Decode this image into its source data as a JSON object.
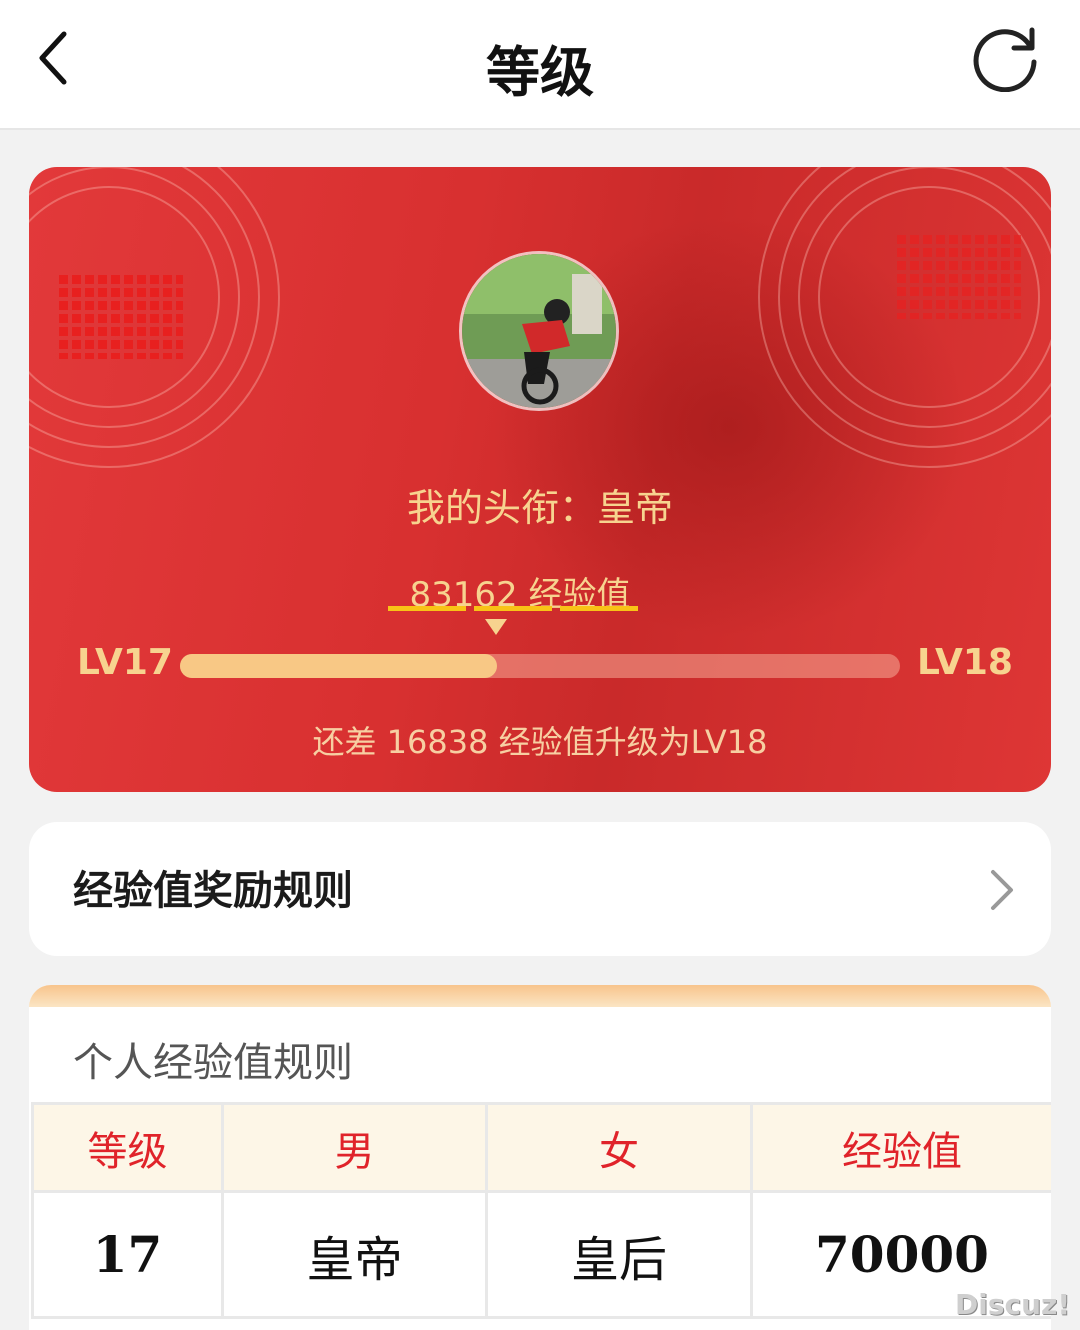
{
  "header": {
    "title": "等级",
    "back_icon": "chevron-left-icon",
    "refresh_icon": "refresh-icon"
  },
  "level_card": {
    "honor_label": "我的头衔：皇帝",
    "current_exp": "83162 经验值",
    "current_level": "LV17",
    "next_level": "LV18",
    "progress_fraction": 0.44,
    "remaining_text": "还差 16838 经验值升级为LV18",
    "colors": {
      "card": "#d83030",
      "gold_text": "#f7d38f",
      "progress_fill": "#f8c885",
      "underline": "#f9c316"
    }
  },
  "rules_link": {
    "label": "经验值奖励规则"
  },
  "exp_table": {
    "caption": "个人经验值规则",
    "columns": [
      "等级",
      "男",
      "女",
      "经验值"
    ],
    "rows": [
      [
        "17",
        "皇帝",
        "皇后",
        "70000"
      ]
    ]
  },
  "watermark": "Discuz!"
}
